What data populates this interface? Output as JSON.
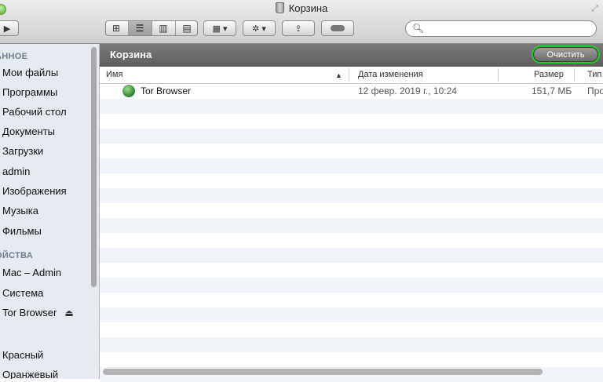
{
  "window": {
    "title": "Корзина"
  },
  "toolbar": {
    "view_buttons": [
      "icon-view",
      "list-view",
      "column-view",
      "cover-flow-view"
    ],
    "arrange_icon": "grid-icon",
    "action_icon": "gear-icon",
    "share_icon": "share-icon",
    "tag_icon": "tag-icon"
  },
  "search": {
    "value": "",
    "placeholder": ""
  },
  "sidebar": {
    "sections": [
      {
        "header": "АННОЕ",
        "items": [
          "Мои файлы",
          "Программы",
          "Рабочий стол",
          "Документы",
          "Загрузки",
          "admin",
          "Изображения",
          "Музыка",
          "Фильмы"
        ]
      },
      {
        "header": "ОЙСТВА",
        "items": [
          "Mac – Admin",
          "Система",
          "Tor Browser"
        ]
      },
      {
        "header": "",
        "items": [
          "Красный",
          "Оранжевый"
        ]
      }
    ]
  },
  "path_bar": {
    "title": "Корзина",
    "empty_button": "Очистить"
  },
  "columns": {
    "name": "Имя",
    "date": "Дата изменения",
    "size": "Размер",
    "kind": "Тип"
  },
  "files": [
    {
      "name": "Tor Browser",
      "date": "12 февр. 2019 г., 10:24",
      "size": "151,7 МБ",
      "kind": "Про"
    }
  ],
  "colors": {
    "highlight": "#1fd01f",
    "sidebar_bg": "#e5eaf1",
    "alt_row": "#f1f5fa"
  }
}
